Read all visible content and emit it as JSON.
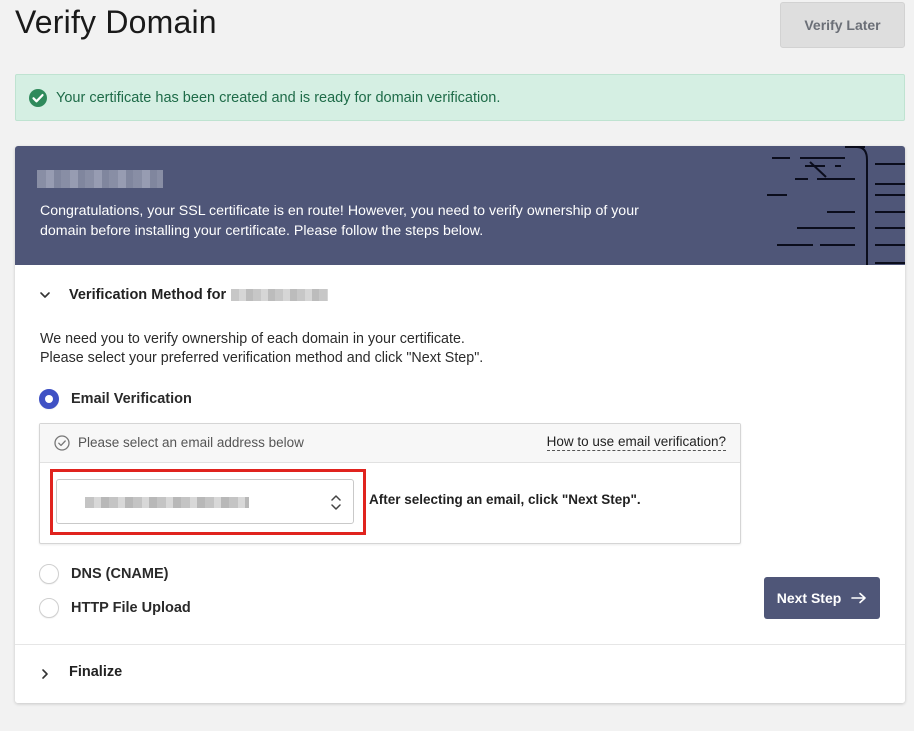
{
  "page": {
    "title": "Verify Domain",
    "verify_later_label": "Verify Later"
  },
  "alert": {
    "text": "Your certificate has been created and is ready for domain verification.",
    "icon": "check-circle-icon",
    "color": "#1e6b48"
  },
  "banner": {
    "domain_redacted": true,
    "text": "Congratulations, your SSL certificate is en route! However, you need to verify ownership of your domain before installing your certificate. Please follow the steps below.",
    "color": "#4f5678"
  },
  "verification_section": {
    "heading": "Verification Method for",
    "domain_redacted": true,
    "expanded": true,
    "intro_line1": "We need you to verify ownership of each domain in your certificate.",
    "intro_line2": "Please select your preferred verification method and click \"Next Step\".",
    "methods": [
      {
        "label": "Email Verification",
        "selected": true
      },
      {
        "label": "DNS (CNAME)",
        "selected": false
      },
      {
        "label": "HTTP File Upload",
        "selected": false
      }
    ],
    "email_box": {
      "title": "Please select an email address below",
      "help_link": "How to use email verification?",
      "selected_email_redacted": true,
      "after_select_text": "After selecting an email, click \"Next Step\"."
    },
    "next_step_label": "Next Step"
  },
  "finalize_section": {
    "heading": "Finalize",
    "expanded": false
  },
  "colors": {
    "accent": "#4f5678",
    "radio_selected": "#3f51c4",
    "highlight": "#e0231e"
  }
}
